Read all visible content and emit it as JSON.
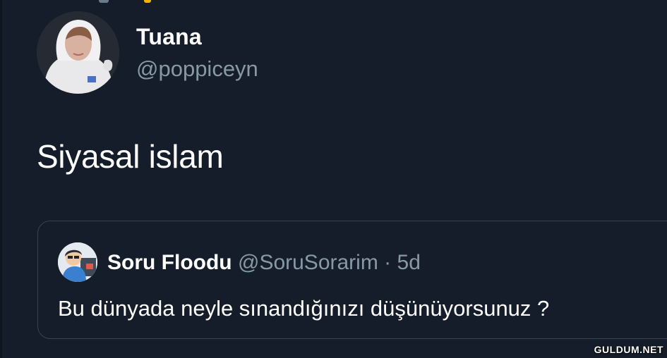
{
  "tweet": {
    "display_name": "Tuana",
    "handle": "@poppiceyn",
    "text": "Siyasal islam"
  },
  "quoted_tweet": {
    "display_name": "Soru Floodu",
    "handle": "@SoruSorarim",
    "separator": "·",
    "time": "5d",
    "text": "Bu dünyada neyle sınandığınızı düşünüyorsunuz ?"
  },
  "watermark": "GULDUM.NET",
  "icons": {
    "avatar": "user-avatar-photo",
    "quote_avatar": "cartoon-avatar-icon"
  },
  "colors": {
    "background": "#141d29",
    "text_primary": "#ffffff",
    "text_secondary": "#8899a6",
    "border": "#38444d"
  }
}
